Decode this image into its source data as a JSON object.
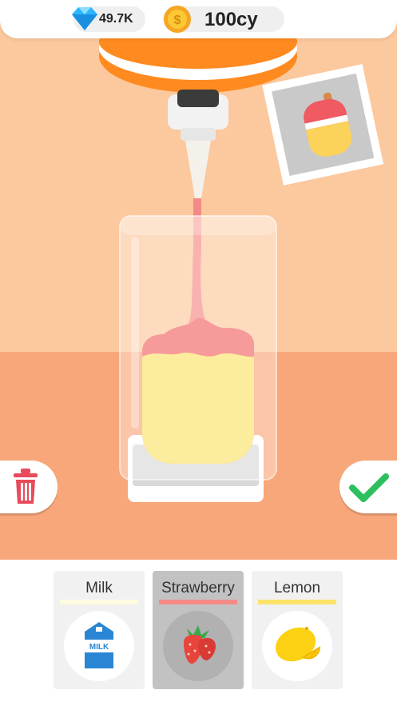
{
  "hud": {
    "gems": "49.7K",
    "coins": "100cy"
  },
  "order": {
    "target_icon": "popsicle-icon"
  },
  "ingredients": [
    {
      "label": "Milk",
      "color": "#fffbe0",
      "icon": "milk-carton-icon",
      "selected": false
    },
    {
      "label": "Strawberry",
      "color": "#f48a88",
      "icon": "strawberry-icon",
      "selected": true
    },
    {
      "label": "Lemon",
      "color": "#fde36a",
      "icon": "lemon-icon",
      "selected": false
    }
  ],
  "actions": {
    "discard_icon": "trash-icon",
    "confirm_icon": "checkmark-icon"
  },
  "colors": {
    "wall": "#fcc89d",
    "counter": "#f8a77a",
    "dispenser_cap": "#ff8a1f",
    "strawberry_liquid": "#f48a88",
    "lemon_liquid": "#fbed9d"
  }
}
